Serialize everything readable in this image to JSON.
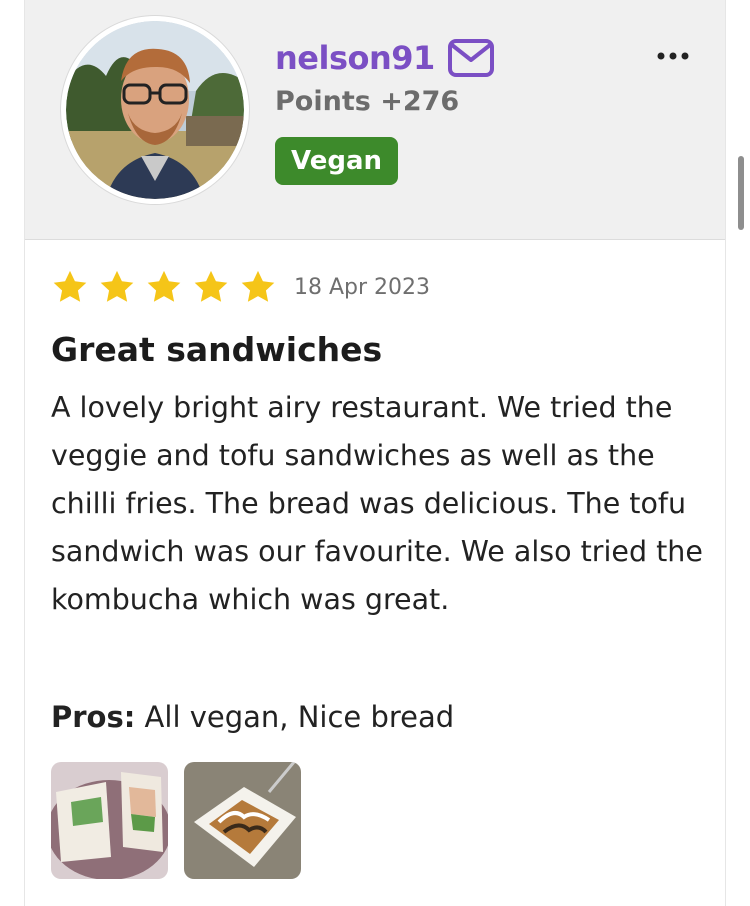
{
  "user": {
    "username": "nelson91",
    "points": "Points +276",
    "badge": "Vegan"
  },
  "review": {
    "rating": 5,
    "max_rating": 5,
    "date": "18 Apr 2023",
    "title": "Great sandwiches",
    "body": "A lovely bright airy restaurant. We tried the veggie and tofu sandwiches as well as the chilli fries. The bread was delicious. The tofu sandwich was our favourite. We also tried the kombucha which was great.",
    "pros_label": "Pros:",
    "pros_text": " All vegan, Nice bread",
    "photos": [
      "sandwich-wrap-photo",
      "chilli-fries-photo"
    ]
  },
  "icons": {
    "mail": "mail-icon",
    "more": "more-options-icon",
    "star": "star-icon"
  },
  "colors": {
    "username": "#7b4fc4",
    "badge_bg": "#3d8a2b",
    "star": "#f5c518",
    "header_bg": "#f0f0f0"
  }
}
